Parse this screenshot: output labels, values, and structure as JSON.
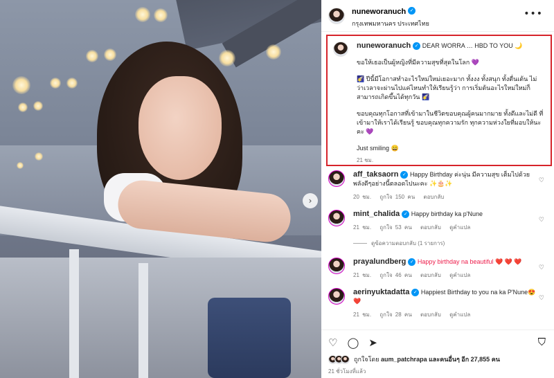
{
  "post": {
    "username": "nuneworanuch",
    "location": "กรุงเทพมหานคร ประเทศไทย",
    "more_label": "•••"
  },
  "caption": {
    "username": "nuneworanuch",
    "line1": "DEAR WORRA … HBD TO YOU 🌙",
    "para1": "ขอให้เธอเป็นผู้หญิงที่มีความสุขที่สุดในโลก 💜",
    "para2": "🌠 ปีนี้มีโอกาสทำอะไรใหม่ใหม่เยอะมาก ทั้งงง ทั้งสนุก ทั้งตื่นเต้น ไม่ว่าเวลาจะผ่านไปแค่ไหนทำให้เรียนรู้ว่า การเริ่มต้นอะไรใหม่ใหม่ก็สามารถเกิดขึ้นได้ทุกวัน 🌠",
    "para3": "ขอบคุณทุกโอกาสที่เข้ามาในชีวิตขอบคุณผู้คนมากมาย ทั้งดีและไม่ดี ที่เข้ามาให้เราได้เรียนรู้ ขอบคุณทุกความรัก ทุกความห่วงใยที่มอบให้นะคะ 💜",
    "para4": "Just smiling 😄",
    "time": "21 ชม."
  },
  "comments": [
    {
      "username": "aff_taksaorn",
      "text": "Happy Birthday ค่ะนุ่น มีความสุข เต็มไปด้วยพลังดีๆอย่างนี้ตลอดไปนะคะ ✨🎂✨",
      "time": "20 ชม.",
      "likes": "ถูกใจ 150 คน",
      "reply": "ตอบกลับ"
    },
    {
      "username": "mint_chalida",
      "text": "Happy birthday ka p'Nune",
      "time": "21 ชม.",
      "likes": "ถูกใจ 53 คน",
      "reply": "ตอบกลับ",
      "translate": "ดูคำแปล"
    },
    {
      "username": "prayalundberg",
      "text": "Happy birthday na beautiful ❤️ ❤️ ❤️",
      "time": "21 ชม.",
      "likes": "ถูกใจ 46 คน",
      "reply": "ตอบกลับ",
      "translate": "ดูคำแปล"
    },
    {
      "username": "aerinyuktadatta",
      "text": "Happiest Birthday to you na ka P'Nune😍 ❤️",
      "time": "21 ชม.",
      "likes": "ถูกใจ 28 คน",
      "reply": "ตอบกลับ",
      "translate": "ดูคำแปล"
    }
  ],
  "view_replies": "ดูข้อความตอบกลับ (1 รายการ)",
  "likes_summary": {
    "prefix": "ถูกใจโดย",
    "user": "aum_patchrapa",
    "suffix": "และคนอื่นๆ อีก 27,855 คน"
  },
  "posted_ago": "21 ชั่วโมงที่แล้ว",
  "icons": {
    "like": "♡",
    "comment": "◯",
    "share": "➤",
    "save": "⛉",
    "next": "›",
    "verified": "✓",
    "comment_like": "♡"
  },
  "colors": {
    "accent": "#0095f6",
    "highlight_border": "#d6232a",
    "story_ring": "#d300c5",
    "heart": "#ed1c4a"
  }
}
